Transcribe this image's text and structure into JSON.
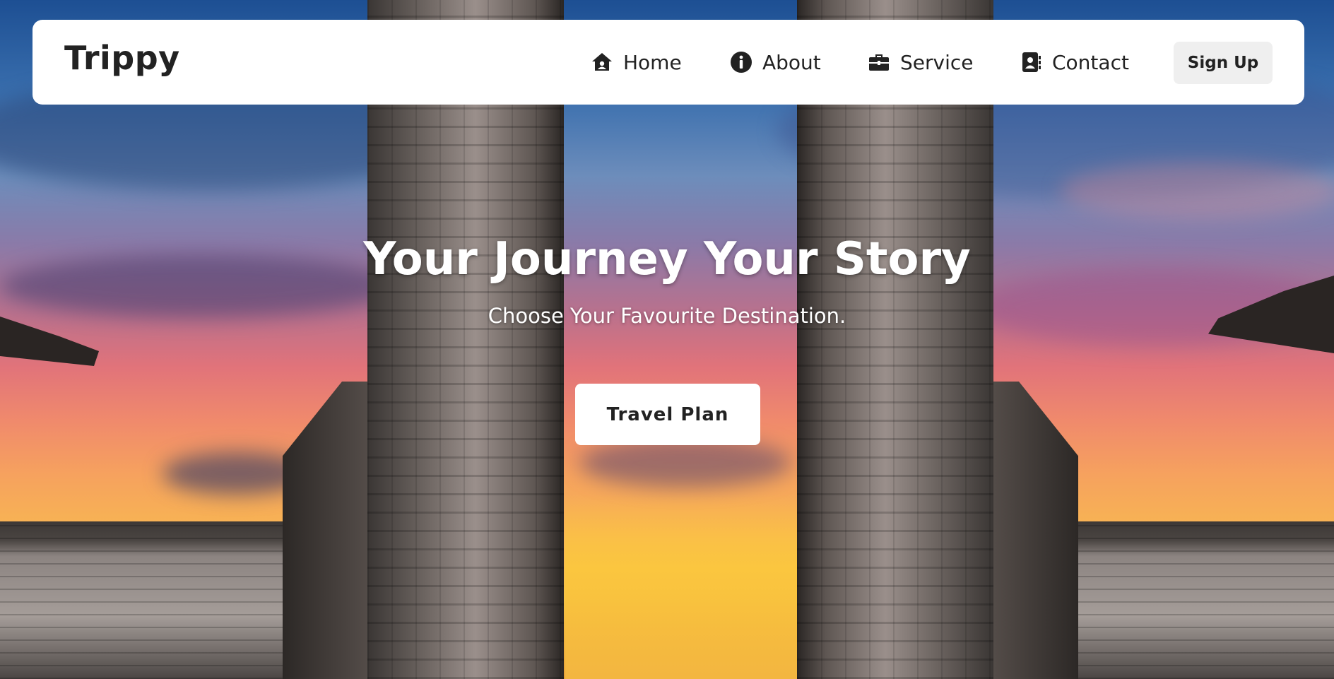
{
  "brand": {
    "name": "Trippy"
  },
  "nav": {
    "items": [
      {
        "label": "Home",
        "icon": "home-icon"
      },
      {
        "label": "About",
        "icon": "info-icon"
      },
      {
        "label": "Service",
        "icon": "briefcase-icon"
      },
      {
        "label": "Contact",
        "icon": "address-book-icon"
      }
    ],
    "signup_label": "Sign Up"
  },
  "hero": {
    "title": "Your Journey Your Story",
    "subtitle": "Choose Your Favourite Destination.",
    "cta_label": "Travel Plan",
    "background": "temple-gate-sunset-photo"
  },
  "colors": {
    "text_dark": "#222222",
    "navbar_bg": "#ffffff",
    "signup_bg": "#efefef",
    "hero_text": "#ffffff"
  }
}
